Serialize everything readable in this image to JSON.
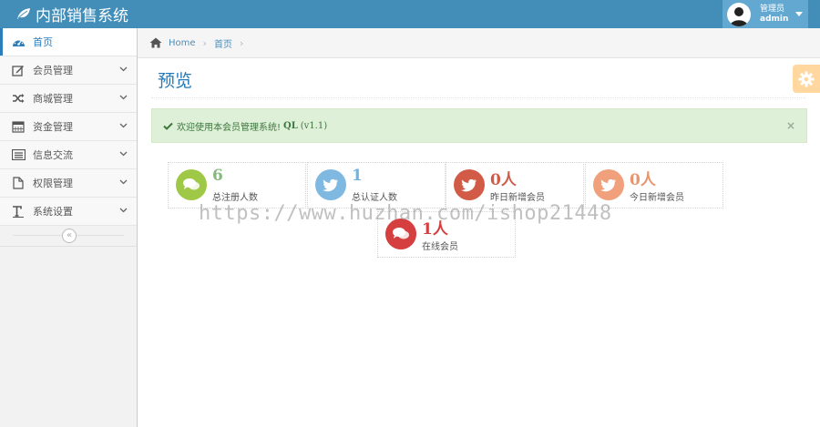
{
  "app": {
    "title": "内部销售系统"
  },
  "user": {
    "role": "管理员",
    "name": "admin"
  },
  "sidebar": {
    "items": [
      {
        "label": "首页",
        "icon": "dashboard-icon",
        "active": true
      },
      {
        "label": "会员管理",
        "icon": "edit-icon"
      },
      {
        "label": "商城管理",
        "icon": "shuffle-icon"
      },
      {
        "label": "资金管理",
        "icon": "calendar-icon"
      },
      {
        "label": "信息交流",
        "icon": "list-icon"
      },
      {
        "label": "权限管理",
        "icon": "file-icon"
      },
      {
        "label": "系统设置",
        "icon": "text-icon"
      }
    ],
    "collapse_glyph": "«"
  },
  "breadcrumb": {
    "home": "Home",
    "current": "首页",
    "sep": "›"
  },
  "page": {
    "title": "预览"
  },
  "alert": {
    "text": "欢迎使用本会员管理系统!",
    "brand": "QL",
    "version": "(v1.1)",
    "close": "×"
  },
  "stats": [
    {
      "value": "6",
      "label": "总注册人数",
      "icon": "comments-icon",
      "color": "#a0c847",
      "text_color": "#87b87f"
    },
    {
      "value": "1",
      "label": "总认证人数",
      "icon": "twitter-icon",
      "color": "#7fb8e0",
      "text_color": "#6fb3e0"
    },
    {
      "value": "0人",
      "label": "昨日新增会员",
      "icon": "twitter-icon",
      "color": "#d15b47",
      "text_color": "#d15b47"
    },
    {
      "value": "0人",
      "label": "今日新增会员",
      "icon": "twitter-icon",
      "color": "#f0a07a",
      "text_color": "#e8956e"
    },
    {
      "value": "1人",
      "label": "在线会员",
      "icon": "comments-icon",
      "color": "#d53f40",
      "text_color": "#d53f40"
    }
  ],
  "watermark": "https://www.huzhan.com/ishop21448"
}
